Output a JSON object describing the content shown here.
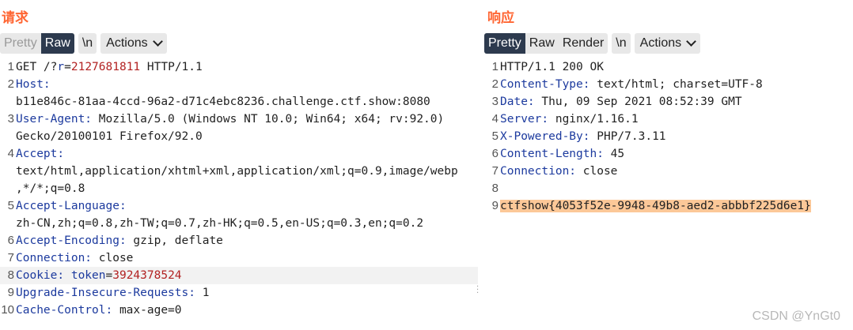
{
  "request": {
    "title": "请求",
    "tabs": {
      "pretty": "Pretty",
      "raw": "Raw",
      "newline": "\\n",
      "actions": "Actions"
    },
    "line_numbers": [
      "1",
      "2",
      "",
      "3",
      "",
      "4",
      "",
      "",
      "5",
      "",
      "6",
      "7",
      "8",
      "9",
      "10"
    ],
    "lines": [
      {
        "p0": "GET /?",
        "p1": "r",
        "p2": "=",
        "p3": "2127681811",
        "p4": " HTTP/1.1"
      },
      {
        "name": "Host:",
        "value": ""
      },
      {
        "text": "b11e846c-81aa-4ccd-96a2-d71c4ebc8236.challenge.ctf.show:8080"
      },
      {
        "name": "User-Agent:",
        "value": " Mozilla/5.0 (Windows NT 10.0; Win64; x64; rv:92.0)"
      },
      {
        "text": "Gecko/20100101 Firefox/92.0"
      },
      {
        "name": "Accept:",
        "value": ""
      },
      {
        "text": "text/html,application/xhtml+xml,application/xml;q=0.9,image/webp"
      },
      {
        "text": ",*/*;q=0.8"
      },
      {
        "name": "Accept-Language:",
        "value": ""
      },
      {
        "text": "zh-CN,zh;q=0.8,zh-TW;q=0.7,zh-HK;q=0.5,en-US;q=0.3,en;q=0.2"
      },
      {
        "name": "Accept-Encoding:",
        "value": " gzip, deflate"
      },
      {
        "name": "Connection:",
        "value": " close"
      },
      {
        "name": "Cookie:",
        "value": " ",
        "cookie_name": "token",
        "eq": "=",
        "cookie_value": "3924378524"
      },
      {
        "name": "Upgrade-Insecure-Requests:",
        "value": " 1"
      },
      {
        "name": "Cache-Control:",
        "value": " max-age=0"
      }
    ]
  },
  "response": {
    "title": "响应",
    "tabs": {
      "pretty": "Pretty",
      "raw": "Raw",
      "render": "Render",
      "newline": "\\n",
      "actions": "Actions"
    },
    "line_numbers": [
      "1",
      "2",
      "3",
      "4",
      "5",
      "6",
      "7",
      "8",
      "9"
    ],
    "lines": [
      {
        "text": "HTTP/1.1 200 OK"
      },
      {
        "name": "Content-Type:",
        "value": " text/html; charset=UTF-8"
      },
      {
        "name": "Date:",
        "value": " Thu, 09 Sep 2021 08:52:39 GMT"
      },
      {
        "name": "Server:",
        "value": " nginx/1.16.1"
      },
      {
        "name": "X-Powered-By:",
        "value": " PHP/7.3.11"
      },
      {
        "name": "Content-Length:",
        "value": " 45"
      },
      {
        "name": "Connection:",
        "value": " close"
      },
      {
        "text": ""
      },
      {
        "text": "ctfshow{4053f52e-9948-49b8-aed2-abbbf225d6e1}"
      }
    ]
  },
  "watermark": "CSDN @YnGt0"
}
